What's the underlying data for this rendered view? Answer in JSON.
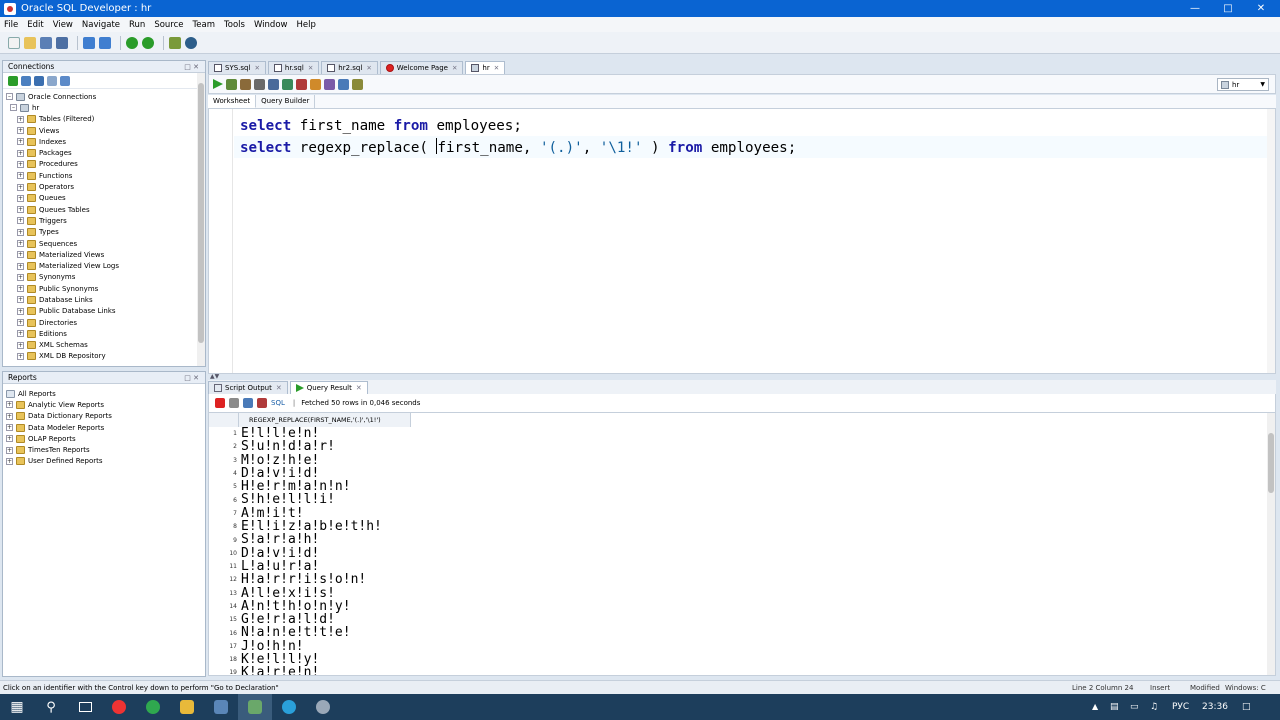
{
  "window": {
    "title": "Oracle SQL Developer : hr"
  },
  "menu": [
    "File",
    "Edit",
    "View",
    "Navigate",
    "Run",
    "Source",
    "Team",
    "Tools",
    "Window",
    "Help"
  ],
  "connections_panel": {
    "title": "Connections",
    "root": "Oracle Connections",
    "connection": "hr",
    "items": [
      "Tables (Filtered)",
      "Views",
      "Indexes",
      "Packages",
      "Procedures",
      "Functions",
      "Operators",
      "Queues",
      "Queues Tables",
      "Triggers",
      "Types",
      "Sequences",
      "Materialized Views",
      "Materialized View Logs",
      "Synonyms",
      "Public Synonyms",
      "Database Links",
      "Public Database Links",
      "Directories",
      "Editions",
      "XML Schemas",
      "XML DB Repository"
    ]
  },
  "reports_panel": {
    "title": "Reports",
    "root": "All Reports",
    "items": [
      "Analytic View Reports",
      "Data Dictionary Reports",
      "Data Modeler Reports",
      "OLAP Reports",
      "TimesTen Reports",
      "User Defined Reports"
    ]
  },
  "editor_tabs": [
    "SYS.sql",
    "hr.sql",
    "hr2.sql",
    "Welcome Page",
    "hr"
  ],
  "sheet": {
    "connection": "hr",
    "subtabs": [
      "Worksheet",
      "Query Builder"
    ],
    "line1": {
      "kw1": "select",
      "t1": " first_name ",
      "kw2": "from",
      "t2": " employees;"
    },
    "line2": {
      "kw1": "select",
      "t1": " regexp_replace( ",
      "t2": "first_name, ",
      "s1": "'(.)'",
      "t3": ", ",
      "s2": "'\\1!'",
      "t4": " ) ",
      "kw2": "from",
      "t5": " employees;"
    }
  },
  "results": {
    "tabs": [
      "Script Output",
      "Query Result"
    ],
    "sql_label": "SQL",
    "fetched": "Fetched 50 rows in 0,046 seconds",
    "column": "REGEXP_REPLACE(FIRST_NAME,'(.)','\\1!')",
    "rows": [
      {
        "n": "1",
        "v": "E!l!l!e!n!"
      },
      {
        "n": "2",
        "v": "S!u!n!d!a!r!"
      },
      {
        "n": "3",
        "v": "M!o!z!h!e!"
      },
      {
        "n": "4",
        "v": "D!a!v!i!d!"
      },
      {
        "n": "5",
        "v": "H!e!r!m!a!n!n!"
      },
      {
        "n": "6",
        "v": "S!h!e!l!l!i!"
      },
      {
        "n": "7",
        "v": "A!m!i!t!"
      },
      {
        "n": "8",
        "v": "E!l!i!z!a!b!e!t!h!"
      },
      {
        "n": "9",
        "v": "S!a!r!a!h!"
      },
      {
        "n": "10",
        "v": "D!a!v!i!d!"
      },
      {
        "n": "11",
        "v": "L!a!u!r!a!"
      },
      {
        "n": "12",
        "v": "H!a!r!r!i!s!o!n!"
      },
      {
        "n": "13",
        "v": "A!l!e!x!i!s!"
      },
      {
        "n": "14",
        "v": "A!n!t!h!o!n!y!"
      },
      {
        "n": "15",
        "v": "G!e!r!a!l!d!"
      },
      {
        "n": "16",
        "v": "N!a!n!e!t!t!e!"
      },
      {
        "n": "17",
        "v": "J!o!h!n!"
      },
      {
        "n": "18",
        "v": "K!e!l!l!y!"
      },
      {
        "n": "19",
        "v": "K!a!r!e!n!"
      }
    ]
  },
  "status": {
    "message": "Click on an identifier with the Control key down to perform \"Go to Declaration\"",
    "position": "Line 2 Column 24",
    "mode": "Insert",
    "modified": "Modified",
    "eol": "Windows: C"
  },
  "taskbar": {
    "lang": "РУС",
    "time": "23:36"
  },
  "colors": {
    "titlebar": "#0a64d2",
    "taskbar": "#1d3e5c",
    "keyword": "#1a1aa6"
  }
}
